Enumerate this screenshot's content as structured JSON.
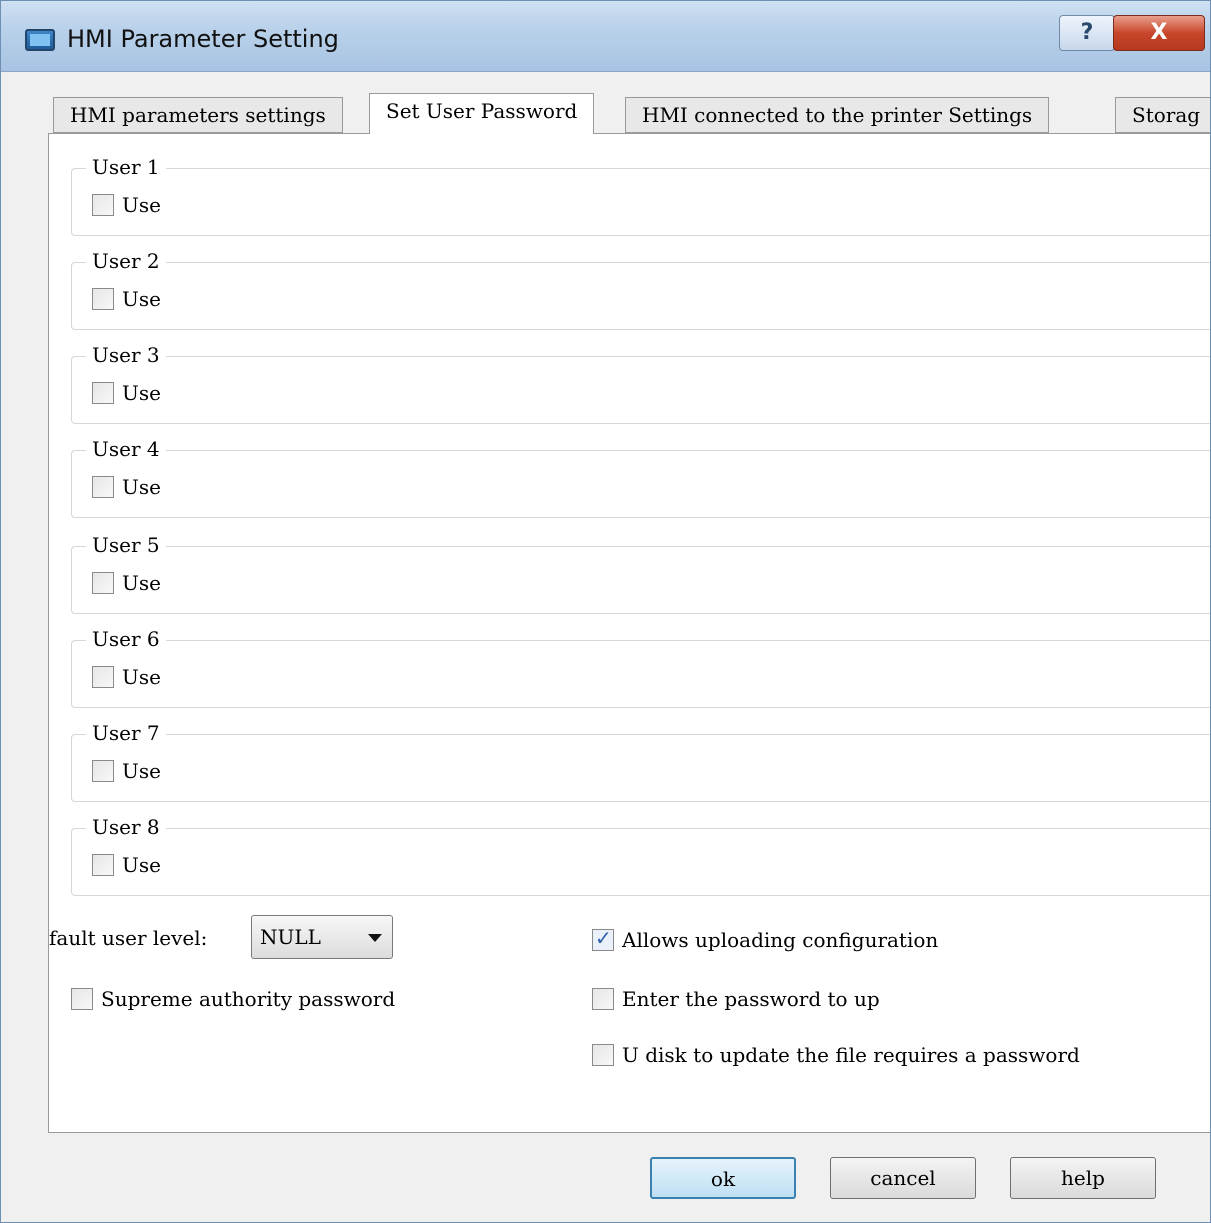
{
  "window": {
    "title": "HMI Parameter Setting",
    "help_glyph": "?",
    "close_glyph": "X"
  },
  "tabs": [
    {
      "label": "HMI parameters settings"
    },
    {
      "label": "Set User Password"
    },
    {
      "label": "HMI connected to the printer Settings"
    },
    {
      "label": "Storag"
    }
  ],
  "active_tab": "Set User Password",
  "users": [
    {
      "legend": "User 1",
      "use_label": "Use",
      "checked": false
    },
    {
      "legend": "User 2",
      "use_label": "Use",
      "checked": false
    },
    {
      "legend": "User 3",
      "use_label": "Use",
      "checked": false
    },
    {
      "legend": "User 4",
      "use_label": "Use",
      "checked": false
    },
    {
      "legend": "User 5",
      "use_label": "Use",
      "checked": false
    },
    {
      "legend": "User 6",
      "use_label": "Use",
      "checked": false
    },
    {
      "legend": "User 7",
      "use_label": "Use",
      "checked": false
    },
    {
      "legend": "User 8",
      "use_label": "Use",
      "checked": false
    }
  ],
  "default_level": {
    "label": "fault user level:",
    "value": "NULL"
  },
  "options": {
    "supreme_password": {
      "label": "Supreme authority password",
      "checked": false
    },
    "allow_upload": {
      "label": "Allows uploading configuration",
      "checked": true
    },
    "password_upload": {
      "label": "Enter the password to up",
      "checked": false
    },
    "udisk_password": {
      "label": "U disk to update the file requires a password",
      "checked": false
    }
  },
  "buttons": {
    "ok": "ok",
    "cancel": "cancel",
    "help": "help"
  }
}
